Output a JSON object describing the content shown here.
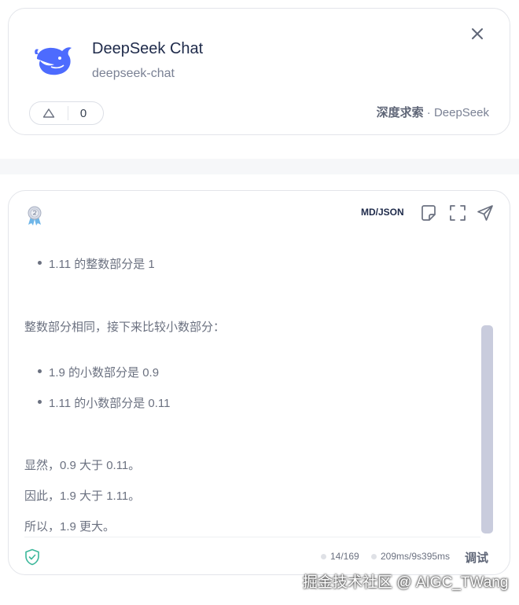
{
  "model_card": {
    "name": "DeepSeek Chat",
    "id": "deepseek-chat",
    "vote_count": "0",
    "provider_cn": "深度求索",
    "provider_sep": " · ",
    "provider_en": "DeepSeek",
    "brand_color": "#4d6bfe",
    "icons": [
      "deepseek-whale-logo",
      "close-icon",
      "thumb-up-icon"
    ]
  },
  "response": {
    "format_toggle": "MD/JSON",
    "toolbar_icons": [
      "copy-icon",
      "fullscreen-icon",
      "send-icon"
    ],
    "rank_icon": "medal-icon",
    "lines": {
      "b1": "1.11 的整数部分是 1",
      "p1": "整数部分相同，接下来比较小数部分：",
      "b2": "1.9 的小数部分是 0.9",
      "b3": "1.11 的小数部分是 0.11",
      "p2": "显然，0.9 大于 0.11。",
      "p3": "因此，1.9 大于 1.11。",
      "p4": "所以，1.9 更大。"
    },
    "footer": {
      "tokens": "14/169",
      "timing": "209ms/9s395ms",
      "debug_label": "调试",
      "shield_icon": "shield-check-icon",
      "shield_color": "#3bb79a"
    }
  },
  "watermark": "掘金技术社区 @ AIGC_TWang"
}
